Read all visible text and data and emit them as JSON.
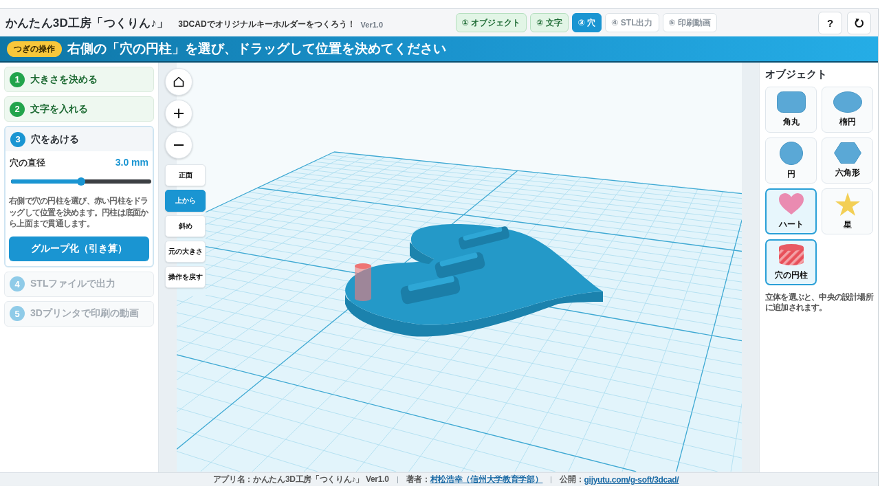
{
  "header": {
    "title": "かんたん3D工房「つくりん♪」",
    "subtitle": "3DCADでオリジナルキーホルダーをつくろう！",
    "version": "Ver1.0",
    "steps": [
      {
        "label": "① オブジェクト",
        "done": true,
        "selected": false
      },
      {
        "label": "② 文字",
        "done": true,
        "selected": false
      },
      {
        "label": "③ 穴",
        "done": false,
        "selected": true
      },
      {
        "label": "④ STL出力",
        "done": false,
        "selected": false
      },
      {
        "label": "⑤ 印刷動画",
        "done": false,
        "selected": false
      }
    ],
    "help": "?"
  },
  "banner": {
    "badge": "つぎの操作",
    "message": "右側の「穴の円柱」を選び、ドラッグして位置を決めてください"
  },
  "steps": [
    {
      "number": "1",
      "label": "大きさを決める",
      "done": true,
      "selected": false,
      "disabled": false
    },
    {
      "number": "2",
      "label": "文字を入れる",
      "done": true,
      "selected": false,
      "disabled": false
    },
    {
      "number": "3",
      "label": "穴をあける",
      "done": false,
      "selected": true,
      "disabled": false,
      "detail": {
        "label": "穴の直径",
        "value": "3.0 mm",
        "level": 0.5,
        "description": "右側で穴の円柱を選び、赤い円柱をドラッグして位置を決めます。円柱は底面から上面まで貫通します。",
        "button": "グループ化（引き算）"
      }
    },
    {
      "number": "4",
      "label": "STLファイルで出力",
      "done": false,
      "selected": false,
      "disabled": true
    },
    {
      "number": "5",
      "label": "3Dプリンタで印刷の動画",
      "done": false,
      "selected": false,
      "disabled": true
    }
  ],
  "view_controls": {
    "views": [
      {
        "label": "正面",
        "selected": false
      },
      {
        "label": "上から",
        "selected": true
      },
      {
        "label": "斜め",
        "selected": false
      }
    ],
    "actions": [
      "元の大きさ",
      "操作を戻す"
    ]
  },
  "objects": {
    "title": "オブジェクト",
    "items": [
      {
        "label": "角丸",
        "kind": "rounded-rect",
        "selected": false
      },
      {
        "label": "楕円",
        "kind": "ellipse",
        "selected": false
      },
      {
        "label": "円",
        "kind": "circle",
        "selected": false
      },
      {
        "label": "六角形",
        "kind": "hexagon",
        "selected": false
      },
      {
        "label": "ハート",
        "kind": "heart",
        "selected": true
      },
      {
        "label": "星",
        "kind": "star",
        "selected": false
      },
      {
        "label": "穴の円柱",
        "kind": "cylinder",
        "selected": true
      }
    ],
    "note": "立体を選ぶと、中央の設計場所に追加されます。"
  },
  "footer": {
    "app": "アプリ名：かんたん3D工房「つくりん♪」 Ver1.0",
    "author_label": "著者：",
    "author_link": "村松浩幸（信州大学教育学部）",
    "site_label": "公開：",
    "site_link": "gijyutu.com/g-soft/3dcad/"
  }
}
